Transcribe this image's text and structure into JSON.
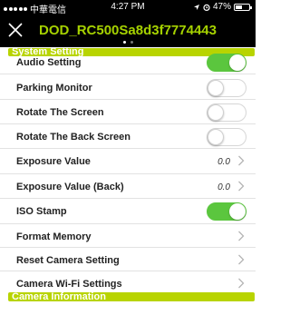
{
  "status_bar": {
    "carrier": "中華電信",
    "time": "4:27 PM",
    "battery": "47%",
    "battery_level": 0.47,
    "signal_dots": 5
  },
  "header": {
    "title": "DOD_RC500Sa8d3f7774443",
    "page_count": 2,
    "active_page": 1,
    "title_color": "#a6d200"
  },
  "sections": {
    "system_setting": "System Setting",
    "camera_information": "Camera Information"
  },
  "settings": [
    {
      "label": "Audio Setting",
      "control": "toggle",
      "on": true
    },
    {
      "label": "Parking Monitor",
      "control": "toggle",
      "on": false
    },
    {
      "label": "Rotate The Screen",
      "control": "toggle",
      "on": false
    },
    {
      "label": "Rotate The Back Screen",
      "control": "toggle",
      "on": false
    },
    {
      "label": "Exposure Value",
      "control": "value",
      "value": "0.0"
    },
    {
      "label": "Exposure Value (Back)",
      "control": "value",
      "value": "0.0"
    },
    {
      "label": "ISO Stamp",
      "control": "toggle",
      "on": true
    },
    {
      "label": "Format Memory",
      "control": "chevron"
    },
    {
      "label": "Reset Camera Setting",
      "control": "chevron"
    },
    {
      "label": "Camera Wi-Fi Settings",
      "control": "chevron"
    }
  ],
  "colors": {
    "accent": "#b8d400",
    "toggle_on": "#5bc63e"
  }
}
